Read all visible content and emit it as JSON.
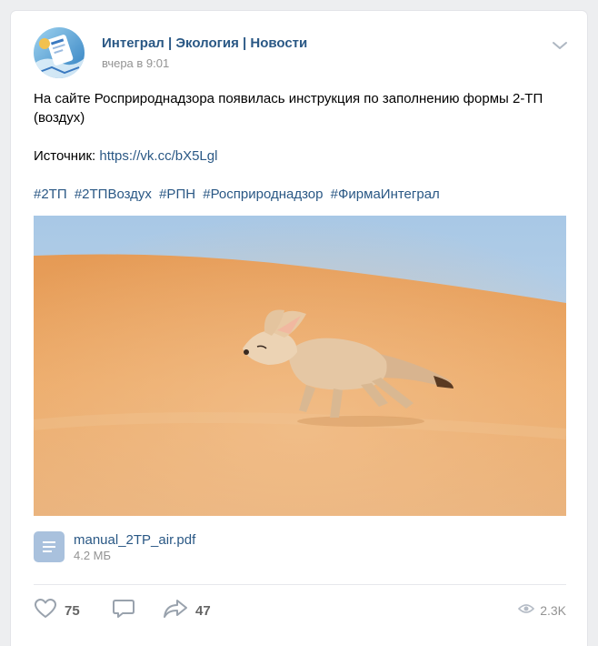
{
  "post": {
    "group_name": "Интеграл | Экология | Новости",
    "time": "вчера в 9:01",
    "text_line1": "На сайте Росприроднадзора появилась инструкция по заполнению формы 2-ТП (воздух)",
    "source_label": "Источник:",
    "source_link": "https://vk.cc/bX5Lgl",
    "hashtags": [
      "#2ТП",
      "#2ТПВоздух",
      "#РПН",
      "#Росприроднадзор",
      "#ФирмаИнтеграл"
    ],
    "photo_subject": "fennec-fox-desert"
  },
  "document": {
    "name": "manual_2TP_air.pdf",
    "size": "4.2 МБ",
    "icon": "document-icon"
  },
  "actions": {
    "likes": "75",
    "comments": "",
    "shares": "47",
    "views": "2.3K"
  },
  "colors": {
    "link": "#2a5885",
    "secondary": "#939393",
    "icon": "#a9c1dd",
    "background": "#edeef0"
  }
}
